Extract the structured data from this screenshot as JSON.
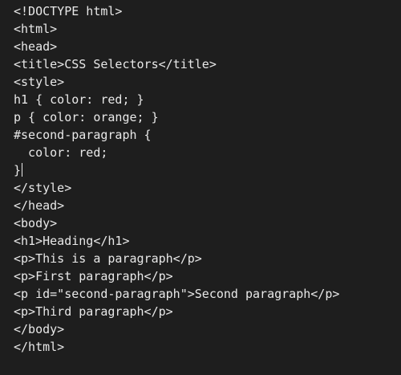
{
  "editor": {
    "lines": [
      "<!DOCTYPE html>",
      "<html>",
      "<head>",
      "<title>CSS Selectors</title>",
      "<style>",
      "h1 { color: red; }",
      "p { color: orange; }",
      "#second-paragraph {",
      "  color: red;",
      "}",
      "</style>",
      "</head>",
      "<body>",
      "<h1>Heading</h1>",
      "<p>This is a paragraph</p>",
      "<p>First paragraph</p>",
      "<p id=\"second-paragraph\">Second paragraph</p>",
      "<p>Third paragraph</p>",
      "</body>",
      "</html>"
    ],
    "caret_line": 9,
    "text_color": "#e8e8e8",
    "background_color": "#1e1e1e"
  }
}
